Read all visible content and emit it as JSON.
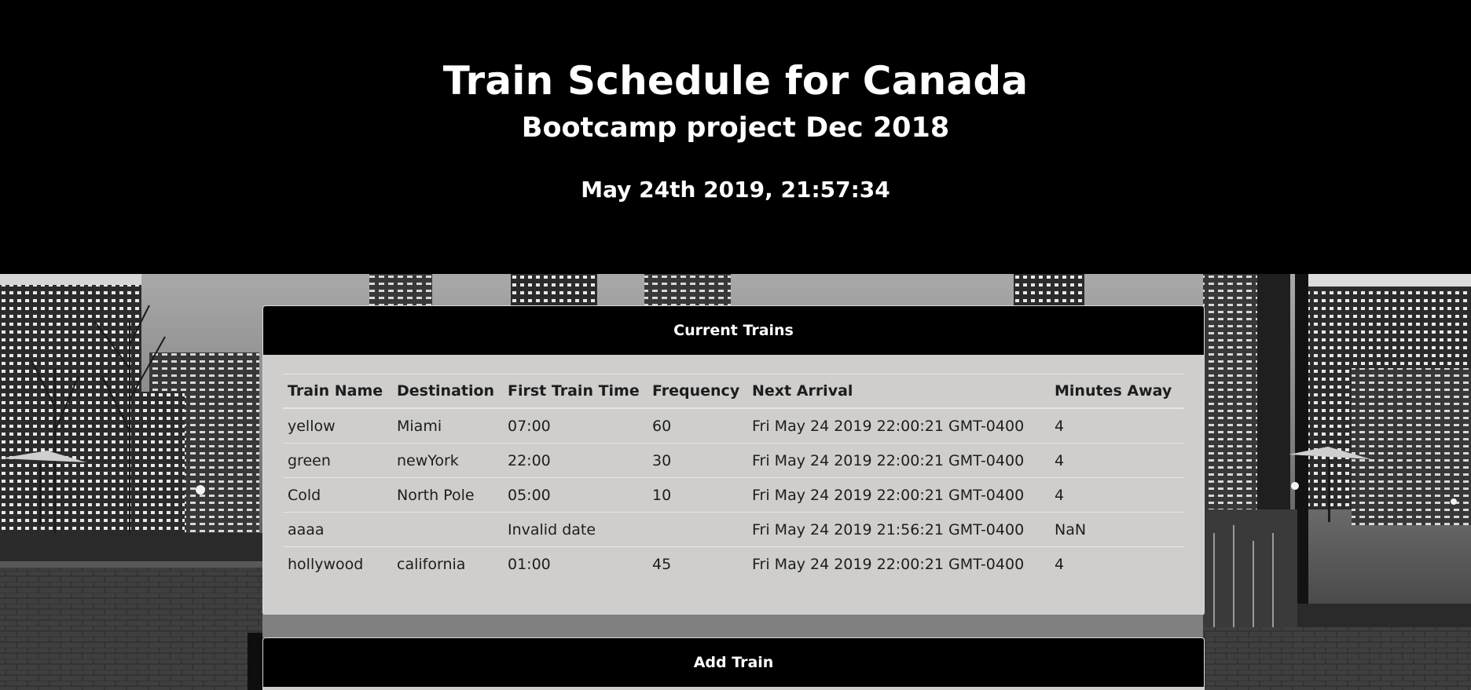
{
  "header": {
    "title": "Train Schedule for Canada",
    "subtitle": "Bootcamp project Dec 2018",
    "clock": "May 24th 2019, 21:57:34"
  },
  "trains_panel": {
    "title": "Current Trains",
    "columns": [
      "Train Name",
      "Destination",
      "First Train Time",
      "Frequency",
      "Next Arrival",
      "Minutes Away"
    ],
    "rows": [
      [
        "yellow",
        "Miami",
        "07:00",
        "60",
        "Fri May 24 2019 22:00:21 GMT-0400",
        "4"
      ],
      [
        "green",
        "newYork",
        "22:00",
        "30",
        "Fri May 24 2019 22:00:21 GMT-0400",
        "4"
      ],
      [
        "Cold",
        "North Pole",
        "05:00",
        "10",
        "Fri May 24 2019 22:00:21 GMT-0400",
        "4"
      ],
      [
        "aaaa",
        "",
        "Invalid date",
        "",
        "Fri May 24 2019 21:56:21 GMT-0400",
        "NaN"
      ],
      [
        "hollywood",
        "california",
        "01:00",
        "45",
        "Fri May 24 2019 22:00:21 GMT-0400",
        "4"
      ]
    ]
  },
  "add_panel": {
    "title": "Add Train"
  },
  "colors": {
    "header_bg": "#000000",
    "panel_bg": "#cfcecd",
    "panel_header_bg": "#000000"
  }
}
